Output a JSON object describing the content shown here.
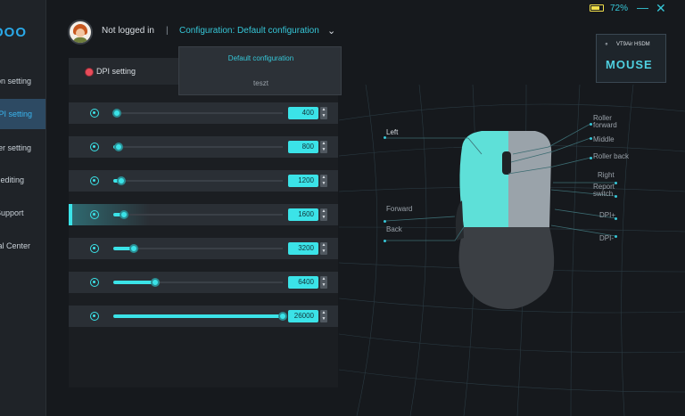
{
  "sidebar": {
    "logo": "OOO",
    "items": [
      {
        "label": "Action setting",
        "active": false
      },
      {
        "label": "DPI setting",
        "active": true
      },
      {
        "label": "Filter setting",
        "active": false
      },
      {
        "label": "Macro editing",
        "active": false
      },
      {
        "label": "Support",
        "active": false
      },
      {
        "label": "Personal Center",
        "active": false
      }
    ]
  },
  "header": {
    "login_status": "Not logged in",
    "separator": "|",
    "configuration_label": "Configuration: Default configuration",
    "dropdown_icon": "chevron-down-icon"
  },
  "dropdown": {
    "options": [
      "Default configuration",
      "teszt"
    ]
  },
  "status": {
    "battery_percent": "72%",
    "battery_level": 0.72,
    "minimize_symbol": "—",
    "close_symbol": "✕"
  },
  "device": {
    "name": "VT9Air HSDM",
    "type": "MOUSE"
  },
  "dpi_panel": {
    "title": "DPI setting",
    "levels": [
      {
        "value": "400",
        "active": false
      },
      {
        "value": "800",
        "active": false
      },
      {
        "value": "1200",
        "active": false
      },
      {
        "value": "1600",
        "active": true
      },
      {
        "value": "3200",
        "active": false
      },
      {
        "value": "6400",
        "active": false
      },
      {
        "value": "26000",
        "active": false
      }
    ],
    "max_dpi": 26000
  },
  "mouse_buttons": {
    "left": "Left",
    "forward": "Forward",
    "back": "Back",
    "roller_forward_1": "Roller",
    "roller_forward_2": "forward",
    "middle": "Middle",
    "roller_back": "Roller back",
    "right": "Right",
    "report_switch_1": "Report",
    "report_switch_2": "switch",
    "dpi_plus": "DPI+",
    "dpi_minus": "DPI-"
  },
  "colors": {
    "accent": "#3be3e8",
    "label": "#36c7d8",
    "active_sidebar": "#3ab5ef",
    "battery": "#f2e04b",
    "indicator": "#e84c5a"
  }
}
